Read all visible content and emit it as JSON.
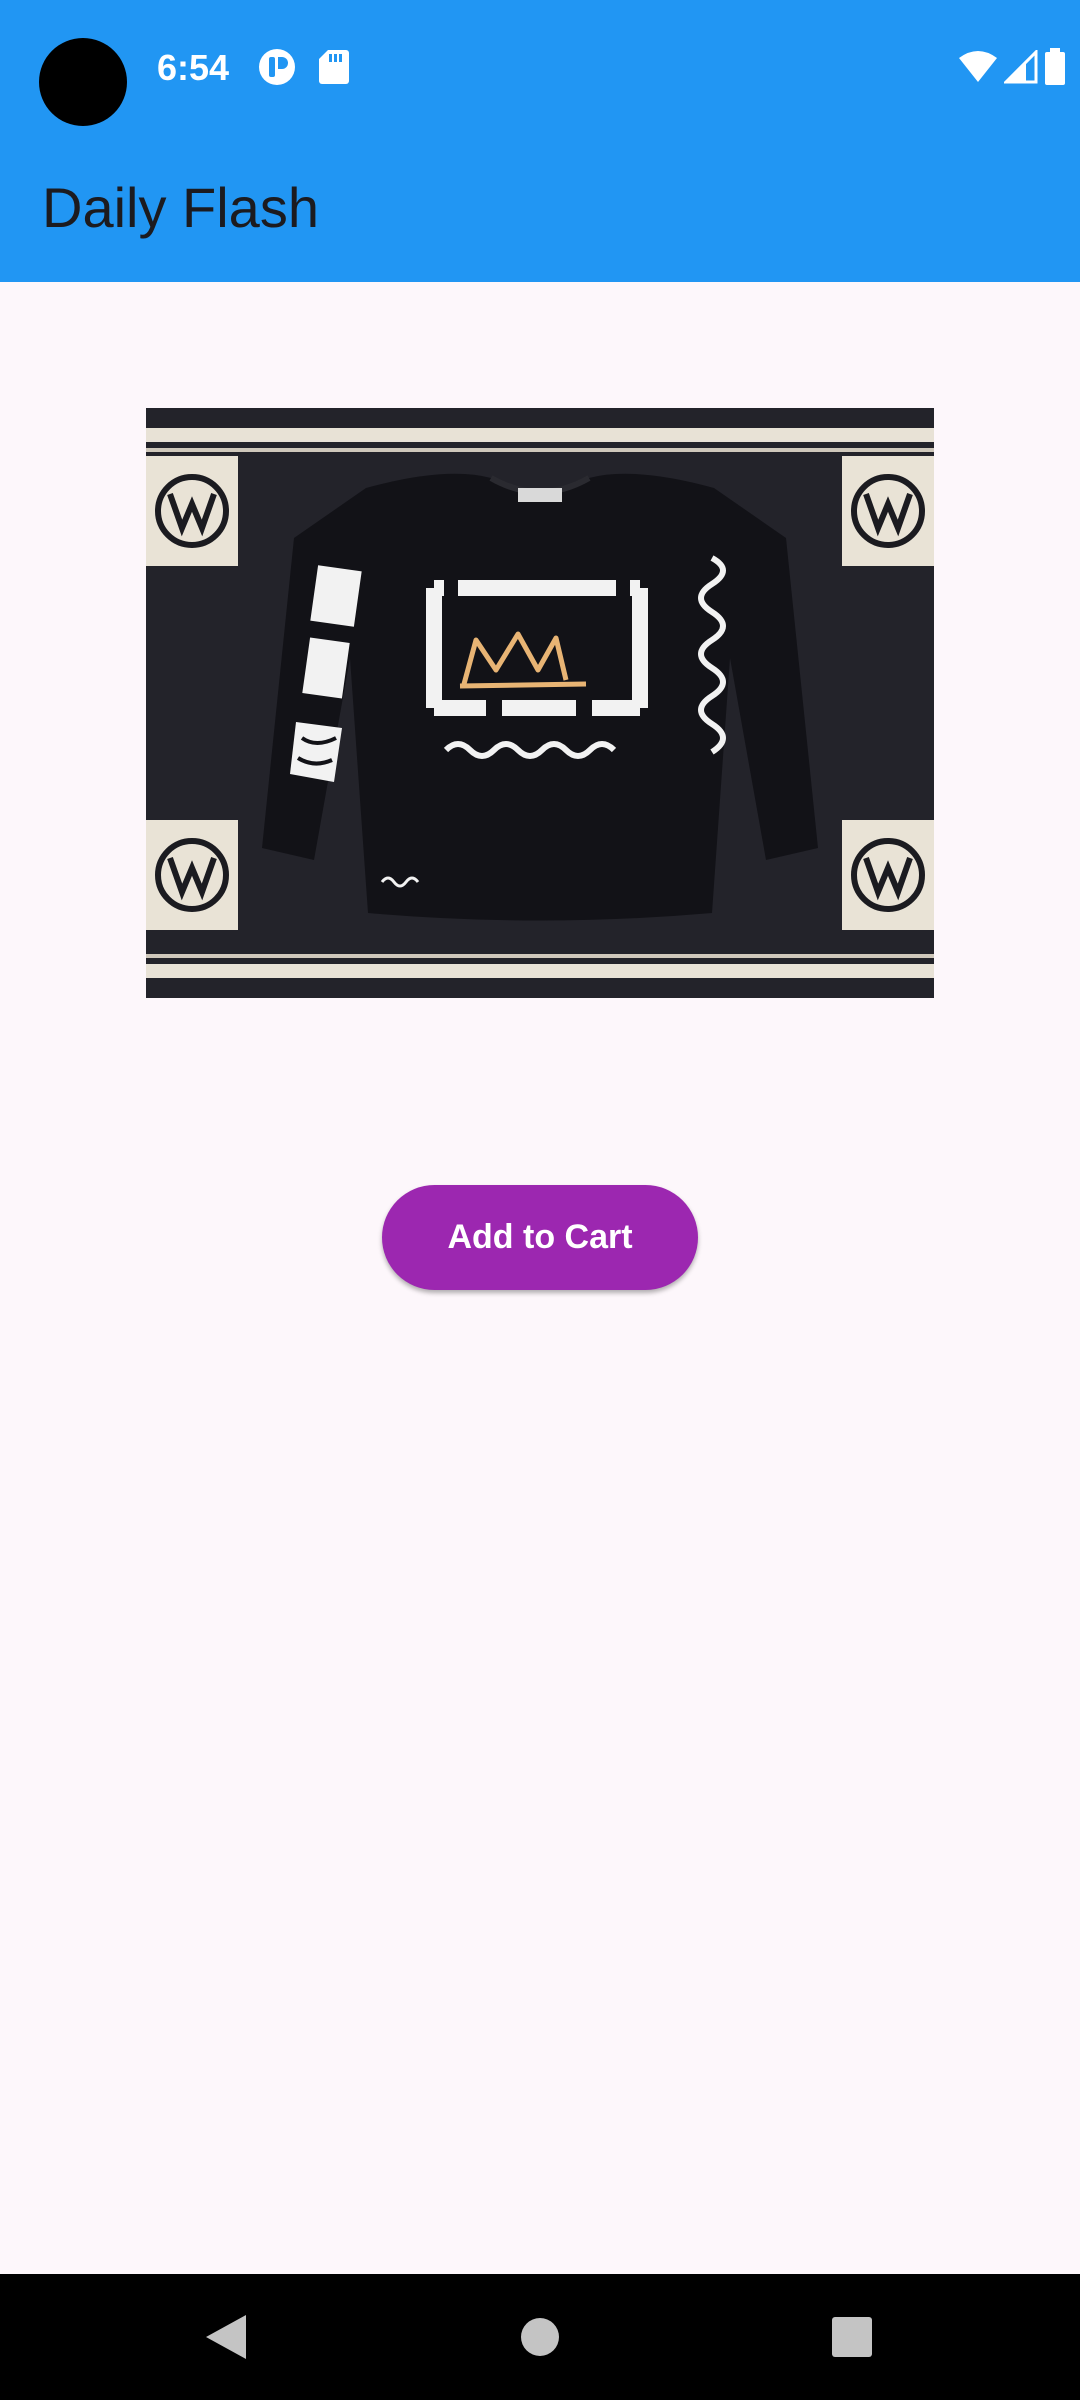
{
  "status_bar": {
    "time": "6:54",
    "icons": [
      "camera-cutout",
      "app-notification-icon",
      "sd-card-icon",
      "wifi-icon",
      "signal-icon",
      "battery-icon"
    ]
  },
  "app_bar": {
    "title": "Daily Flash",
    "color": "#2196f3"
  },
  "product": {
    "image_description": "black long-sleeve t-shirt with crown graphic on rug"
  },
  "actions": {
    "add_to_cart_label": "Add to Cart",
    "button_color": "#9c27b0"
  },
  "navigation_bar": {
    "buttons": [
      "back-icon",
      "home-icon",
      "recents-icon"
    ]
  }
}
